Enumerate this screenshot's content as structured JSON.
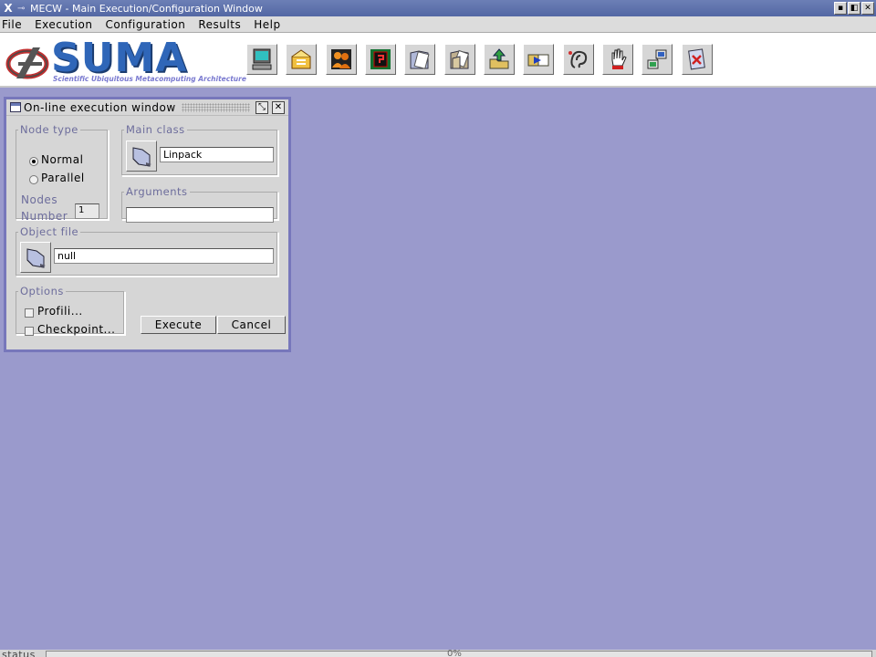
{
  "window": {
    "title": "MECW - Main Execution/Configuration Window",
    "buttons": [
      "▪",
      "◧",
      "✕"
    ]
  },
  "menubar": {
    "items": [
      "File",
      "Execution",
      "Configuration",
      "Results",
      "Help"
    ]
  },
  "logo": {
    "word": "SUMA",
    "tagline": "Scientific Ubiquitous Metacomputing Architecture"
  },
  "toolbar": {
    "icons": [
      "computer-icon",
      "mail-box-icon",
      "users-icon",
      "chip-icon",
      "folder-doc-icon",
      "folder-open-doc-icon",
      "upload-icon",
      "transfer-icon",
      "ear-icon",
      "hand-stop-icon",
      "network-icon",
      "delete-doc-icon"
    ]
  },
  "dialog": {
    "title": "On-line execution window",
    "node_type": {
      "legend": "Node type",
      "options": [
        "Normal",
        "Parallel"
      ],
      "selected": "Normal"
    },
    "nodes": {
      "label1": "Nodes",
      "label2": "Number",
      "value": "1"
    },
    "main_class": {
      "legend": "Main class",
      "value": "Linpack"
    },
    "arguments": {
      "legend": "Arguments",
      "value": ""
    },
    "object_file": {
      "legend": "Object file",
      "value": "null"
    },
    "options": {
      "legend": "Options",
      "items": [
        "Profili...",
        "Checkpoint..."
      ]
    },
    "execute_label": "Execute",
    "cancel_label": "Cancel"
  },
  "status": {
    "label": "status",
    "progress_text": "0%",
    "progress_fraction": 0
  },
  "colors": {
    "desktop": "#9a9acc",
    "titlebar": "#5f72ad",
    "frame_border": "#7777bb",
    "logo_blue": "#2f66b8"
  }
}
